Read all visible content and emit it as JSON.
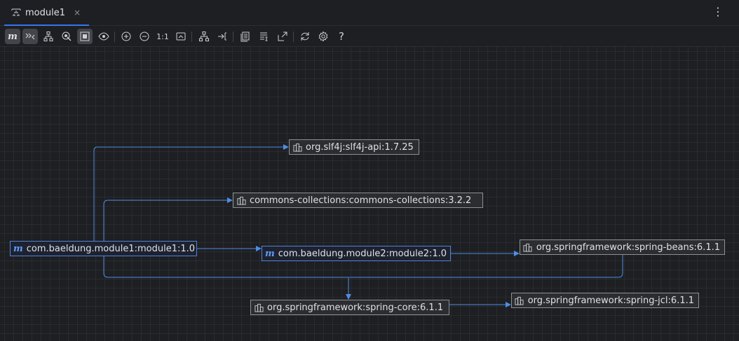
{
  "tab": {
    "title": "module1",
    "close_glyph": "×"
  },
  "menu_glyph": "⋮",
  "toolbar": {
    "m_label": "m",
    "actual_size_label": "1:1",
    "help_label": "?"
  },
  "graph": {
    "nodes": [
      {
        "id": "module1",
        "label": "com.baeldung.module1:module1:1.0",
        "kind": "module"
      },
      {
        "id": "module2",
        "label": "com.baeldung.module2:module2:1.0",
        "kind": "module"
      },
      {
        "id": "slf4j",
        "label": "org.slf4j:slf4j-api:1.7.25",
        "kind": "library"
      },
      {
        "id": "collections",
        "label": "commons-collections:commons-collections:3.2.2",
        "kind": "library"
      },
      {
        "id": "spring_beans",
        "label": "org.springframework:spring-beans:6.1.1",
        "kind": "library"
      },
      {
        "id": "spring_core",
        "label": "org.springframework:spring-core:6.1.1",
        "kind": "library"
      },
      {
        "id": "spring_jcl",
        "label": "org.springframework:spring-jcl:6.1.1",
        "kind": "library"
      }
    ],
    "edges": [
      {
        "from": "module1",
        "to": "slf4j"
      },
      {
        "from": "module1",
        "to": "collections"
      },
      {
        "from": "module1",
        "to": "module2"
      },
      {
        "from": "module1",
        "to": "spring_core"
      },
      {
        "from": "module2",
        "to": "spring_beans"
      },
      {
        "from": "spring_beans",
        "to": "spring_core"
      },
      {
        "from": "spring_core",
        "to": "spring_jcl"
      }
    ]
  },
  "colors": {
    "edge": "#4d8ee6",
    "module_icon": "#5d9cf5",
    "node_border": "#8c8f94"
  }
}
